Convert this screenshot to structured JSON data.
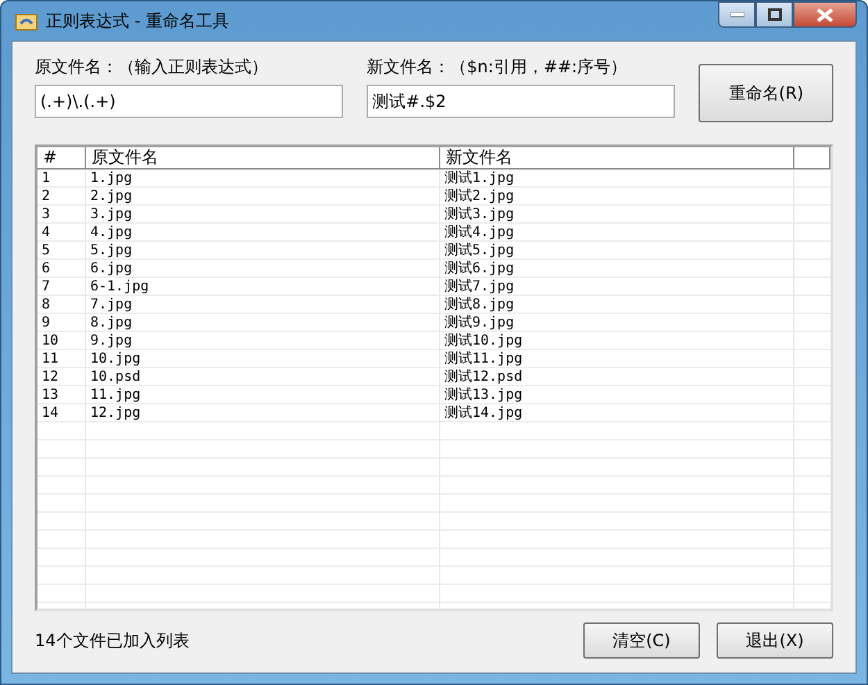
{
  "window": {
    "title": "正则表达式 - 重命名工具"
  },
  "source_field": {
    "label": "原文件名：（输入正则表达式）",
    "value": "(.+)\\.(.+)"
  },
  "target_field": {
    "label": "新文件名：（$n:引用，##:序号）",
    "value": "测试#.$2"
  },
  "rename_button": "重命名(R)",
  "table": {
    "columns": [
      "#",
      "原文件名",
      "新文件名"
    ],
    "rows": [
      [
        "1",
        "1.jpg",
        "测试1.jpg"
      ],
      [
        "2",
        "2.jpg",
        "测试2.jpg"
      ],
      [
        "3",
        "3.jpg",
        "测试3.jpg"
      ],
      [
        "4",
        "4.jpg",
        "测试4.jpg"
      ],
      [
        "5",
        "5.jpg",
        "测试5.jpg"
      ],
      [
        "6",
        "6.jpg",
        "测试6.jpg"
      ],
      [
        "7",
        "6-1.jpg",
        "测试7.jpg"
      ],
      [
        "8",
        "7.jpg",
        "测试8.jpg"
      ],
      [
        "9",
        "8.jpg",
        "测试9.jpg"
      ],
      [
        "10",
        "9.jpg",
        "测试10.jpg"
      ],
      [
        "11",
        "10.jpg",
        "测试11.jpg"
      ],
      [
        "12",
        "10.psd",
        "测试12.psd"
      ],
      [
        "13",
        "11.jpg",
        "测试13.jpg"
      ],
      [
        "14",
        "12.jpg",
        "测试14.jpg"
      ]
    ]
  },
  "status_bar": "14个文件已加入列表",
  "buttons": [
    "清空(C)",
    "退出(X)"
  ]
}
